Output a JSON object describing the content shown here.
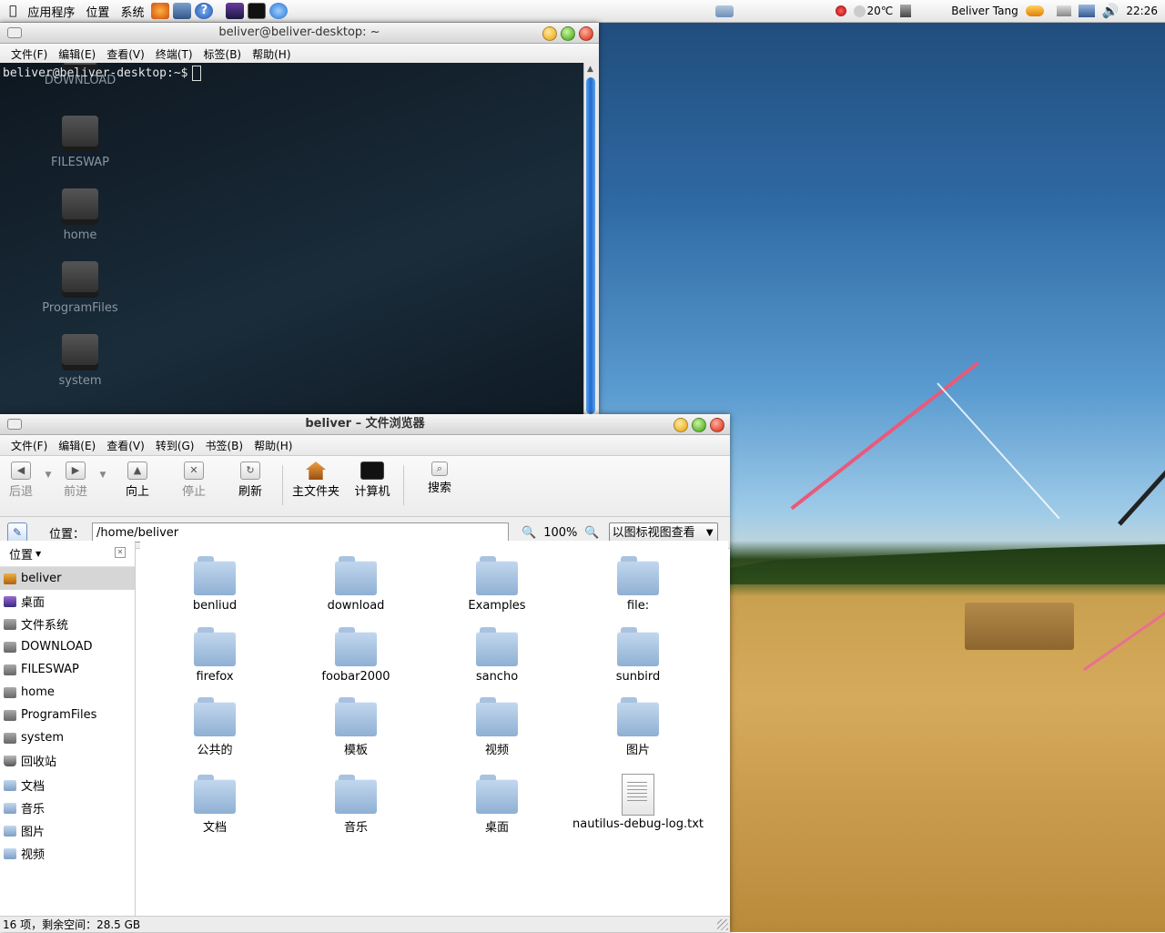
{
  "panel": {
    "menus": [
      "应用程序",
      "位置",
      "系统"
    ],
    "temperature": "20℃",
    "user": "Beliver Tang",
    "clock": "22:26"
  },
  "terminal": {
    "title": "beliver@beliver-desktop: ~",
    "menus": [
      "文件(F)",
      "编辑(E)",
      "查看(V)",
      "终端(T)",
      "标签(B)",
      "帮助(H)"
    ],
    "prompt": "beliver@beliver-desktop:~$"
  },
  "desktop_icons": [
    "DOWNLOAD",
    "FILESWAP",
    "home",
    "ProgramFiles",
    "system"
  ],
  "filebrowser": {
    "title": "beliver – 文件浏览器",
    "menus": [
      "文件(F)",
      "编辑(E)",
      "查看(V)",
      "转到(G)",
      "书签(B)",
      "帮助(H)"
    ],
    "toolbar": {
      "back": "后退",
      "forward": "前进",
      "up": "向上",
      "stop": "停止",
      "refresh": "刷新",
      "home": "主文件夹",
      "computer": "计算机",
      "search": "搜索"
    },
    "location_label": "位置：",
    "location_value": "/home/beliver",
    "zoom": "100%",
    "view_mode": "以图标视图查看",
    "sidebar_title": "位置",
    "sidebar": [
      {
        "label": "beliver",
        "icon": "home"
      },
      {
        "label": "桌面",
        "icon": "desk"
      },
      {
        "label": "文件系统",
        "icon": "drive"
      },
      {
        "label": "DOWNLOAD",
        "icon": "drive"
      },
      {
        "label": "FILESWAP",
        "icon": "drive"
      },
      {
        "label": "home",
        "icon": "drive"
      },
      {
        "label": "ProgramFiles",
        "icon": "drive"
      },
      {
        "label": "system",
        "icon": "drive"
      },
      {
        "label": "回收站",
        "icon": "trash"
      },
      {
        "label": "文档",
        "icon": "folder"
      },
      {
        "label": "音乐",
        "icon": "folder"
      },
      {
        "label": "图片",
        "icon": "folder"
      },
      {
        "label": "视频",
        "icon": "folder"
      }
    ],
    "files": [
      "benliud",
      "download",
      "Examples",
      "file:",
      "firefox",
      "foobar2000",
      "sancho",
      "sunbird",
      "公共的",
      "模板",
      "视频",
      "图片",
      "文档",
      "音乐",
      "桌面",
      "nautilus-debug-log.txt"
    ],
    "status": "16 项，剩余空间：28.5 GB"
  }
}
